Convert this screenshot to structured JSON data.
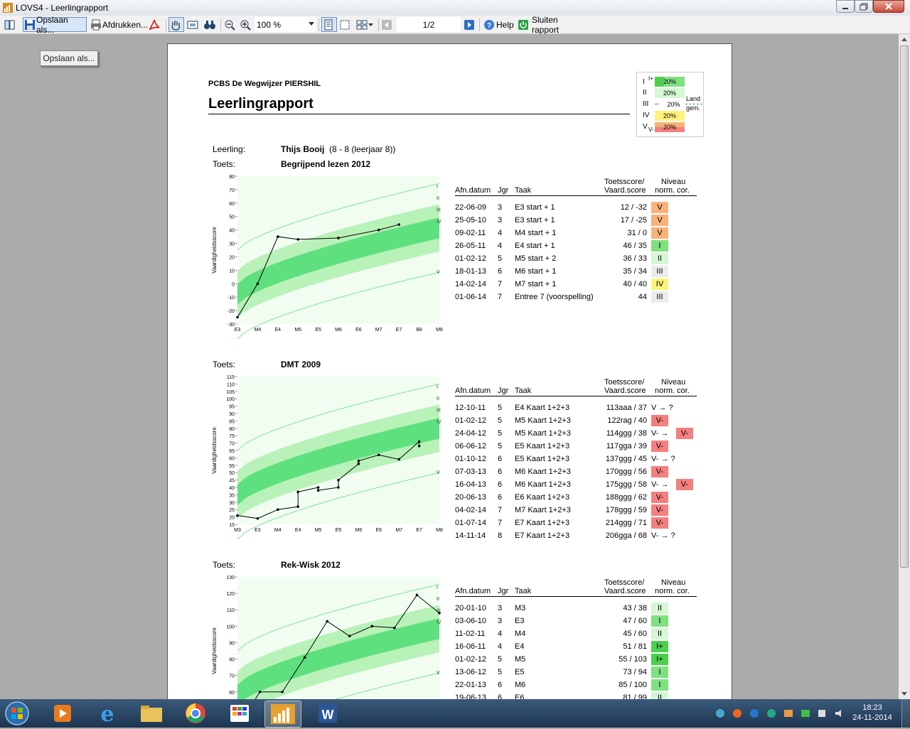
{
  "window": {
    "title": "LOVS4 - Leerlingrapport"
  },
  "toolbar": {
    "save_label": "Opslaan als...",
    "print_label": "Afdrukken...",
    "zoom_value": "100 %",
    "page_indicator": "1/2",
    "help_label": "Help",
    "close_report_label": "Sluiten rapport"
  },
  "tooltip": {
    "text": "Opslaan als..."
  },
  "report": {
    "school": "PCBS De Wegwijzer PIERSHIL",
    "title": "Leerlingrapport",
    "legend": {
      "levels": [
        "I",
        "II",
        "III",
        "IV",
        "V"
      ],
      "i_plus": "I+",
      "v_minus": "V-",
      "percent": "20%",
      "dashes": "--",
      "land_label_1": "Land",
      "land_label_2": "gem."
    },
    "leerling_label": "Leerling:",
    "leerling_name": "Thijs Booij",
    "leerling_detail": "(8 - 8 (leerjaar 8))",
    "toets_label": "Toets:",
    "table_headers": {
      "afn_datum": "Afn.datum",
      "jgr": "Jgr",
      "taak": "Taak",
      "score_line1": "Toetsscore/",
      "score_line2": "Vaard.score",
      "niveau_line1": "Niveau",
      "niveau_line2": "norm. cor."
    },
    "y_axis_label": "Vaardigheidsscore",
    "arrow": "→",
    "level_colors": {
      "I+": "#4ccf4c",
      "I": "#7fe07f",
      "II": "#d4f7d4",
      "III": "#ececec",
      "IV": "#fff27a",
      "V": "#f7b27a",
      "V-": "#f47f7f"
    },
    "tests": [
      {
        "name": "Begrijpend lezen 2012",
        "rows": [
          {
            "date": "22-06-09",
            "jgr": "3",
            "taak": "E3 start + 1",
            "score": "12 / -32",
            "niveau": "V",
            "arrow": "",
            "niveau2": ""
          },
          {
            "date": "25-05-10",
            "jgr": "3",
            "taak": "E3 start + 1",
            "score": "17 / -25",
            "niveau": "V",
            "arrow": "",
            "niveau2": ""
          },
          {
            "date": "09-02-11",
            "jgr": "4",
            "taak": "M4 start + 1",
            "score": "31 / 0",
            "niveau": "V",
            "arrow": "",
            "niveau2": ""
          },
          {
            "date": "26-05-11",
            "jgr": "4",
            "taak": "E4 start + 1",
            "score": "46 / 35",
            "niveau": "I",
            "arrow": "",
            "niveau2": ""
          },
          {
            "date": "01-02-12",
            "jgr": "5",
            "taak": "M5 start + 2",
            "score": "36 / 33",
            "niveau": "II",
            "arrow": "",
            "niveau2": ""
          },
          {
            "date": "18-01-13",
            "jgr": "6",
            "taak": "M6 start + 1",
            "score": "35 / 34",
            "niveau": "III",
            "arrow": "",
            "niveau2": ""
          },
          {
            "date": "14-02-14",
            "jgr": "7",
            "taak": "M7 start + 1",
            "score": "40 / 40",
            "niveau": "IV",
            "arrow": "",
            "niveau2": ""
          },
          {
            "date": "01-06-14",
            "jgr": "7",
            "taak": "Entree 7 (voorspelling)",
            "score": "44",
            "niveau": "III",
            "arrow": "",
            "niveau2": ""
          }
        ]
      },
      {
        "name": "DMT 2009",
        "rows": [
          {
            "date": "12-10-11",
            "jgr": "5",
            "taak": "E4 Kaart 1+2+3",
            "score": "113aaa / 37",
            "niveau": "",
            "arrow": "V  →  ?",
            "niveau2": ""
          },
          {
            "date": "01-02-12",
            "jgr": "5",
            "taak": "M5 Kaart 1+2+3",
            "score": "122rag / 40",
            "niveau": "V-",
            "arrow": "",
            "niveau2": ""
          },
          {
            "date": "24-04-12",
            "jgr": "5",
            "taak": "M5 Kaart 1+2+3",
            "score": "114ggg / 38",
            "niveau": "",
            "arrow": "V-  →",
            "niveau2": "V-"
          },
          {
            "date": "06-06-12",
            "jgr": "5",
            "taak": "E5 Kaart 1+2+3",
            "score": "117gga / 39",
            "niveau": "V-",
            "arrow": "",
            "niveau2": ""
          },
          {
            "date": "01-10-12",
            "jgr": "6",
            "taak": "E5 Kaart 1+2+3",
            "score": "137ggg / 45",
            "niveau": "",
            "arrow": "V-  →  ?",
            "niveau2": ""
          },
          {
            "date": "07-03-13",
            "jgr": "6",
            "taak": "M6 Kaart 1+2+3",
            "score": "170ggg / 56",
            "niveau": "V-",
            "arrow": "",
            "niveau2": ""
          },
          {
            "date": "16-04-13",
            "jgr": "6",
            "taak": "M6 Kaart 1+2+3",
            "score": "175ggg / 58",
            "niveau": "",
            "arrow": "V-  →",
            "niveau2": "V-"
          },
          {
            "date": "20-06-13",
            "jgr": "6",
            "taak": "E6 Kaart 1+2+3",
            "score": "188ggg / 62",
            "niveau": "V-",
            "arrow": "",
            "niveau2": ""
          },
          {
            "date": "04-02-14",
            "jgr": "7",
            "taak": "M7 Kaart 1+2+3",
            "score": "178ggg / 59",
            "niveau": "V-",
            "arrow": "",
            "niveau2": ""
          },
          {
            "date": "01-07-14",
            "jgr": "7",
            "taak": "E7 Kaart 1+2+3",
            "score": "214ggg / 71",
            "niveau": "V-",
            "arrow": "",
            "niveau2": ""
          },
          {
            "date": "14-11-14",
            "jgr": "8",
            "taak": "E7 Kaart 1+2+3",
            "score": "206gga / 68",
            "niveau": "",
            "arrow": "V-  →  ?",
            "niveau2": ""
          }
        ]
      },
      {
        "name": "Rek-Wisk 2012",
        "rows": [
          {
            "date": "20-01-10",
            "jgr": "3",
            "taak": "M3",
            "score": "43 / 38",
            "niveau": "II",
            "arrow": "",
            "niveau2": ""
          },
          {
            "date": "03-06-10",
            "jgr": "3",
            "taak": "E3",
            "score": "47 / 60",
            "niveau": "I",
            "arrow": "",
            "niveau2": ""
          },
          {
            "date": "11-02-11",
            "jgr": "4",
            "taak": "M4",
            "score": "45 / 60",
            "niveau": "II",
            "arrow": "",
            "niveau2": ""
          },
          {
            "date": "16-06-11",
            "jgr": "4",
            "taak": "E4",
            "score": "51 / 81",
            "niveau": "I+",
            "arrow": "",
            "niveau2": ""
          },
          {
            "date": "01-02-12",
            "jgr": "5",
            "taak": "M5",
            "score": "55 / 103",
            "niveau": "I+",
            "arrow": "",
            "niveau2": ""
          },
          {
            "date": "13-06-12",
            "jgr": "5",
            "taak": "E5",
            "score": "73 / 94",
            "niveau": "I",
            "arrow": "",
            "niveau2": ""
          },
          {
            "date": "22-01-13",
            "jgr": "6",
            "taak": "M6",
            "score": "85 / 100",
            "niveau": "I",
            "arrow": "",
            "niveau2": ""
          },
          {
            "date": "19-06-13",
            "jgr": "6",
            "taak": "E6",
            "score": "81 / 99",
            "niveau": "II",
            "arrow": "",
            "niveau2": ""
          }
        ]
      }
    ]
  },
  "chart_data": [
    {
      "type": "line",
      "title": "Begrijpend lezen 2012",
      "ylabel": "Vaardigheidsscore",
      "ylim": [
        -30,
        80
      ],
      "yticks": [
        -30,
        -20,
        -10,
        0,
        10,
        20,
        30,
        40,
        50,
        60,
        70,
        80
      ],
      "xticks": [
        "E3",
        "M4",
        "E4",
        "M5",
        "E5",
        "M6",
        "E6",
        "M7",
        "E7",
        "B8",
        "M8"
      ],
      "level_labels": [
        "I",
        "II",
        "III",
        "IV",
        "V"
      ],
      "x": [
        0,
        1,
        2,
        3,
        5,
        7,
        8
      ],
      "y": [
        -25,
        0,
        35,
        33,
        34,
        40,
        44
      ]
    },
    {
      "type": "line",
      "title": "DMT 2009",
      "ylabel": "Vaardigheidsscore",
      "ylim": [
        15,
        115
      ],
      "yticks": [
        15,
        20,
        25,
        30,
        35,
        40,
        45,
        50,
        55,
        60,
        65,
        70,
        75,
        80,
        85,
        90,
        95,
        100,
        105,
        110,
        115
      ],
      "xticks": [
        "M3",
        "E3",
        "M4",
        "E4",
        "M5",
        "E5",
        "M6",
        "E6",
        "M7",
        "E7",
        "M8"
      ],
      "level_labels": [
        "I",
        "II",
        "III",
        "IV",
        "V"
      ],
      "x": [
        0,
        1,
        2,
        3,
        3,
        4,
        4,
        5,
        5,
        6,
        6,
        7,
        8,
        9,
        9
      ],
      "y": [
        21,
        19,
        25,
        27,
        37,
        40,
        38,
        40,
        45,
        56,
        58,
        62,
        59,
        71,
        68
      ]
    },
    {
      "type": "line",
      "title": "Rek-Wisk 2012",
      "ylabel": "Vaardigheidsscore",
      "ylim": [
        40,
        130
      ],
      "yticks": [
        40,
        50,
        60,
        70,
        80,
        90,
        100,
        110,
        120,
        130
      ],
      "level_labels": [
        "I",
        "II",
        "III",
        "IV",
        "V"
      ],
      "x": [
        0,
        1,
        2,
        3,
        4,
        5,
        6,
        7,
        8,
        9
      ],
      "y": [
        38,
        60,
        60,
        81,
        103,
        94,
        100,
        99,
        119,
        108
      ]
    }
  ]
}
